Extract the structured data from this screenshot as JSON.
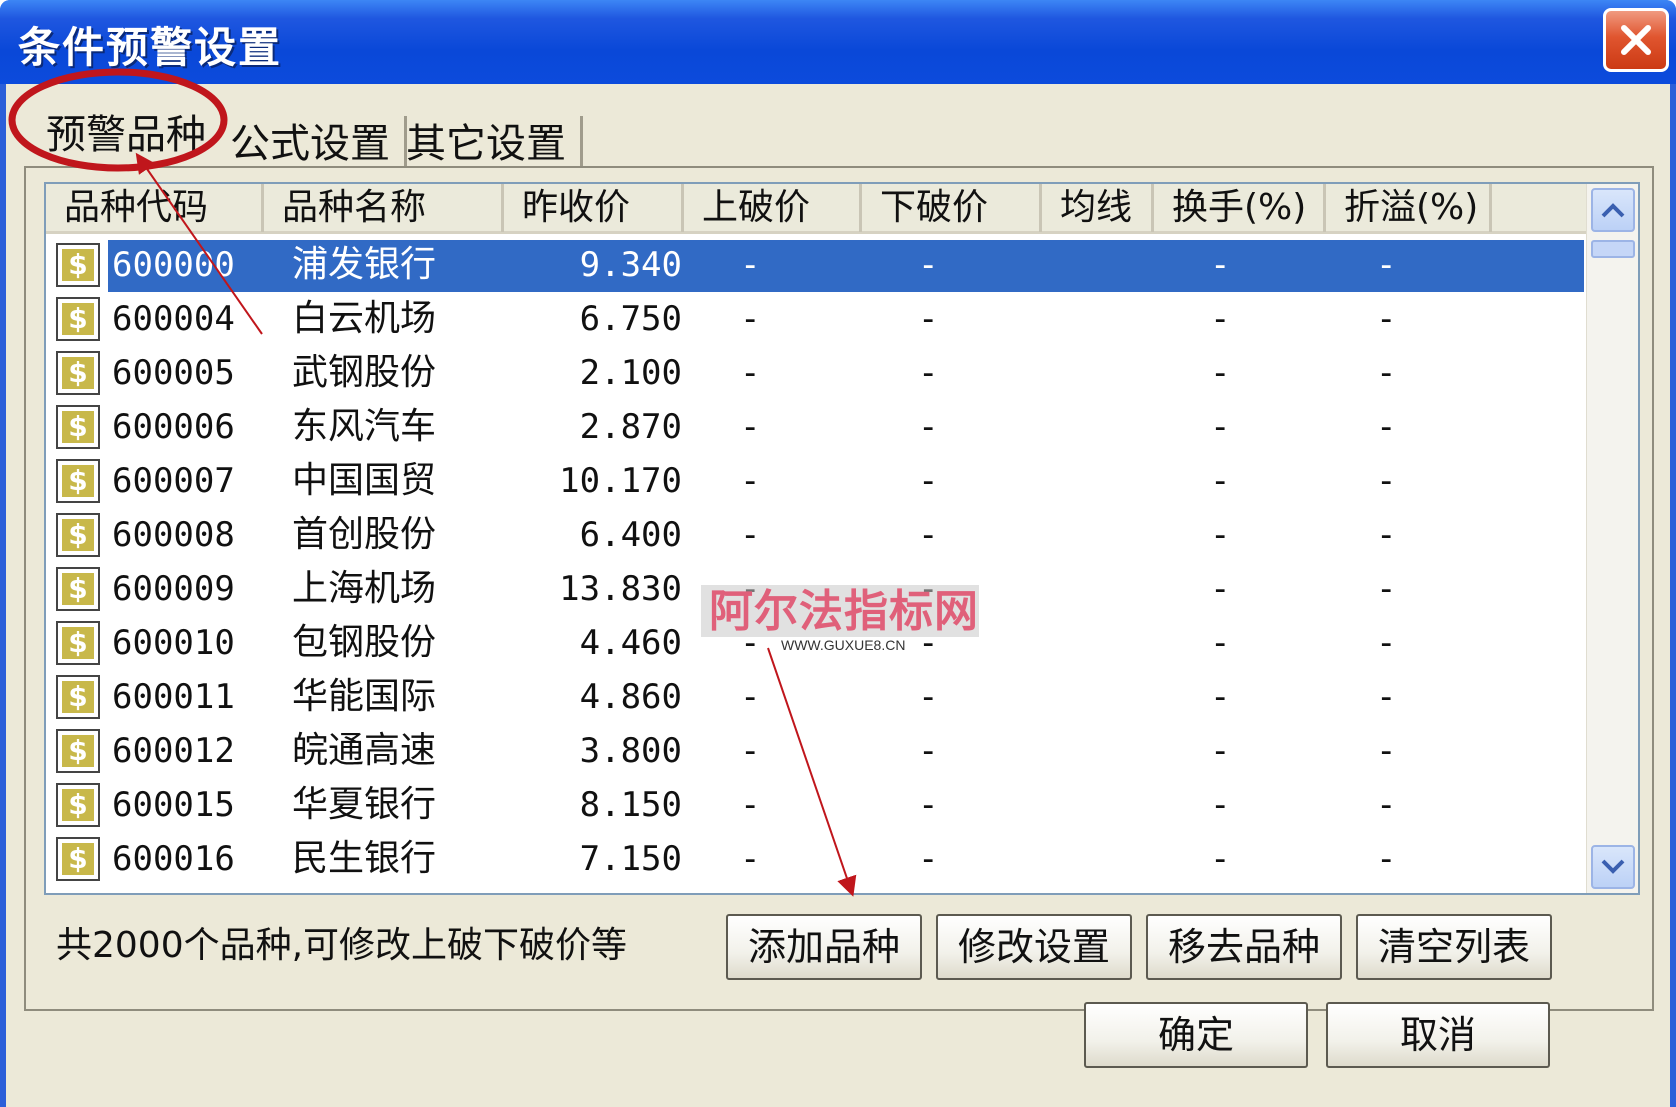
{
  "window": {
    "title": "条件预警设置",
    "close_icon": "close-icon"
  },
  "tabs": [
    {
      "label": "预警品种",
      "active": true
    },
    {
      "label": "公式设置",
      "active": false
    },
    {
      "label": "其它设置",
      "active": false
    }
  ],
  "table": {
    "columns": [
      "品种代码",
      "品种名称",
      "昨收价",
      "上破价",
      "下破价",
      "均线",
      "换手(%)",
      "折溢(%)"
    ],
    "rows": [
      {
        "code": "600000",
        "name": "浦发银行",
        "prev_close": "9.340",
        "up_break": "-",
        "down_break": "-",
        "ma": "",
        "turnover": "-",
        "premium": "-",
        "selected": true
      },
      {
        "code": "600004",
        "name": "白云机场",
        "prev_close": "6.750",
        "up_break": "-",
        "down_break": "-",
        "ma": "",
        "turnover": "-",
        "premium": "-"
      },
      {
        "code": "600005",
        "name": "武钢股份",
        "prev_close": "2.100",
        "up_break": "-",
        "down_break": "-",
        "ma": "",
        "turnover": "-",
        "premium": "-"
      },
      {
        "code": "600006",
        "name": "东风汽车",
        "prev_close": "2.870",
        "up_break": "-",
        "down_break": "-",
        "ma": "",
        "turnover": "-",
        "premium": "-"
      },
      {
        "code": "600007",
        "name": "中国国贸",
        "prev_close": "10.170",
        "up_break": "-",
        "down_break": "-",
        "ma": "",
        "turnover": "-",
        "premium": "-"
      },
      {
        "code": "600008",
        "name": "首创股份",
        "prev_close": "6.400",
        "up_break": "-",
        "down_break": "-",
        "ma": "",
        "turnover": "-",
        "premium": "-"
      },
      {
        "code": "600009",
        "name": "上海机场",
        "prev_close": "13.830",
        "up_break": "-",
        "down_break": "-",
        "ma": "",
        "turnover": "-",
        "premium": "-"
      },
      {
        "code": "600010",
        "name": "包钢股份",
        "prev_close": "4.460",
        "up_break": "-",
        "down_break": "-",
        "ma": "",
        "turnover": "-",
        "premium": "-"
      },
      {
        "code": "600011",
        "name": "华能国际",
        "prev_close": "4.860",
        "up_break": "-",
        "down_break": "-",
        "ma": "",
        "turnover": "-",
        "premium": "-"
      },
      {
        "code": "600012",
        "name": "皖通高速",
        "prev_close": "3.800",
        "up_break": "-",
        "down_break": "-",
        "ma": "",
        "turnover": "-",
        "premium": "-"
      },
      {
        "code": "600015",
        "name": "华夏银行",
        "prev_close": "8.150",
        "up_break": "-",
        "down_break": "-",
        "ma": "",
        "turnover": "-",
        "premium": "-"
      },
      {
        "code": "600016",
        "name": "民生银行",
        "prev_close": "7.150",
        "up_break": "-",
        "down_break": "-",
        "ma": "",
        "turnover": "-",
        "premium": "-"
      }
    ]
  },
  "status_text": "共2000个品种,可修改上破下破价等",
  "buttons": {
    "add": "添加品种",
    "modify": "修改设置",
    "remove": "移去品种",
    "clear": "清空列表",
    "ok": "确定",
    "cancel": "取消"
  },
  "watermark": {
    "title": "阿尔法指标网",
    "url": "WWW.GUXUE8.CN"
  },
  "colors": {
    "title_bar": "#0a48d8",
    "selection": "#316ac5",
    "dialog_bg": "#ece9d8",
    "annotation": "#c0161c"
  }
}
